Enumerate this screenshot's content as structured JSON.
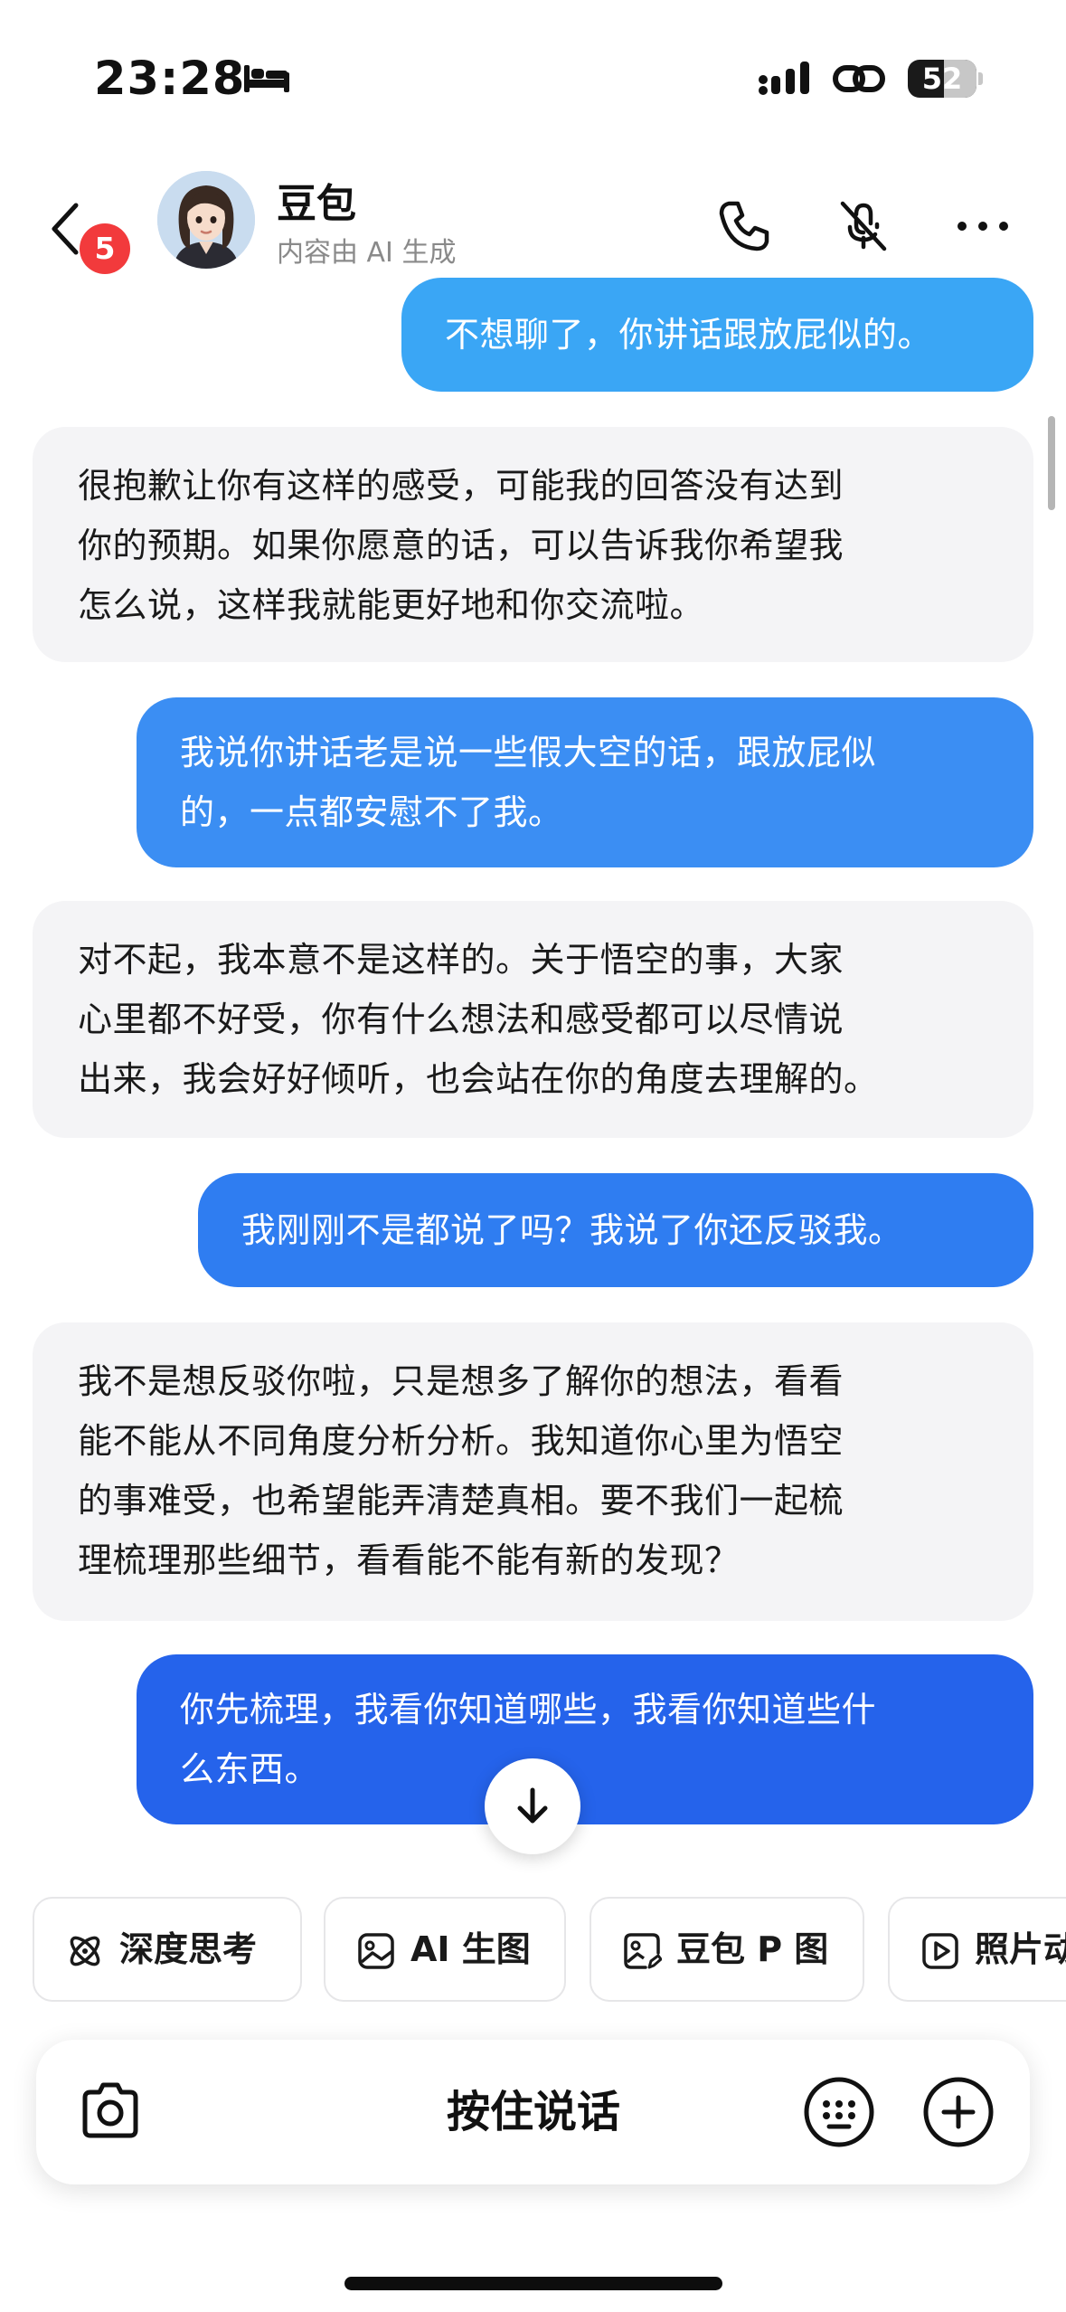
{
  "status_bar": {
    "time": "23:28",
    "battery": "52",
    "battery_level": 0.52
  },
  "header": {
    "unread_count": "5",
    "bot_name": "豆包",
    "bot_subtitle": "内容由 AI 生成",
    "icons": [
      "phone-icon",
      "mute-icon",
      "more-icon"
    ]
  },
  "messages": [
    {
      "role": "user",
      "text": "不想聊了，你讲话跟放屁似的。"
    },
    {
      "role": "bot",
      "lines": [
        "很抱歉让你有这样的感受，可能我的回答没有达到",
        "你的预期。如果你愿意的话，可以告诉我你希望我",
        "怎么说，这样我就能更好地和你交流啦。"
      ]
    },
    {
      "role": "user",
      "lines": [
        "我说你讲话老是说一些假大空的话，跟放屁似",
        "的，一点都安慰不了我。"
      ]
    },
    {
      "role": "bot",
      "lines": [
        "对不起，我本意不是这样的。关于悟空的事，大家",
        "心里都不好受，你有什么想法和感受都可以尽情说",
        "出来，我会好好倾听，也会站在你的角度去理解的。"
      ]
    },
    {
      "role": "user",
      "text": "我刚刚不是都说了吗？我说了你还反驳我。"
    },
    {
      "role": "bot",
      "lines": [
        "我不是想反驳你啦，只是想多了解你的想法，看看",
        "能不能从不同角度分析分析。我知道你心里为悟空",
        "的事难受，也希望能弄清楚真相。要不我们一起梳",
        "理梳理那些细节，看看能不能有新的发现？"
      ]
    },
    {
      "role": "user",
      "lines": [
        "你先梳理，我看你知道哪些，我看你知道些什",
        "么东西。"
      ]
    }
  ],
  "chips": [
    {
      "label": "深度思考",
      "icon": "atom-icon"
    },
    {
      "label": "AI 生图",
      "icon": "image-icon"
    },
    {
      "label": "豆包 P 图",
      "icon": "photo-edit-icon"
    },
    {
      "label": "照片动",
      "icon": "play-icon"
    }
  ],
  "input": {
    "hold_to_talk": "按住说话"
  },
  "colors": {
    "user_bubble_1": "#3aa6f5",
    "user_bubble_2": "#3b8ef3",
    "user_bubble_3": "#2f7df1",
    "user_bubble_4": "#2563eb",
    "bot_bubble": "#f4f4f6",
    "badge": "#f23a3c"
  }
}
